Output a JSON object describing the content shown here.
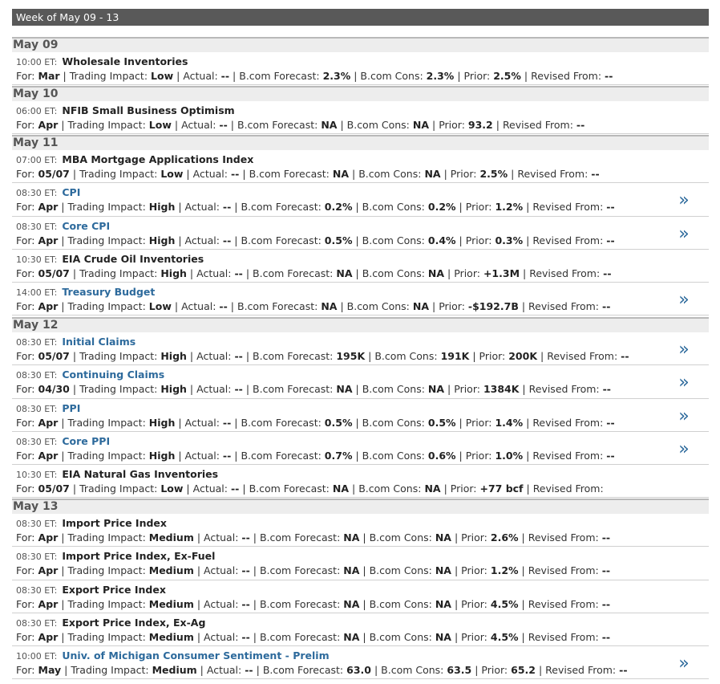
{
  "week_title": "Week of May 09 - 13",
  "labels": {
    "et": "ET:",
    "for": "For:",
    "impact": "Trading Impact:",
    "actual": "Actual:",
    "forecast": "B.com Forecast:",
    "cons": "B.com Cons:",
    "prior": "Prior:",
    "revised": "Revised From:",
    "sep": "|"
  },
  "arrow_glyph": "»",
  "days": [
    {
      "date": "May 09",
      "events": [
        {
          "time": "10:00",
          "name": "Wholesale Inventories",
          "link": false,
          "for": "Mar",
          "impact": "Low",
          "actual": "--",
          "forecast": "2.3%",
          "cons": "2.3%",
          "prior": "2.5%",
          "revised": "--",
          "arrow": false
        }
      ]
    },
    {
      "date": "May 10",
      "events": [
        {
          "time": "06:00",
          "name": "NFIB Small Business Optimism",
          "link": false,
          "for": "Apr",
          "impact": "Low",
          "actual": "--",
          "forecast": "NA",
          "cons": "NA",
          "prior": "93.2",
          "revised": "--",
          "arrow": false
        }
      ]
    },
    {
      "date": "May 11",
      "events": [
        {
          "time": "07:00",
          "name": "MBA Mortgage Applications Index",
          "link": false,
          "for": "05/07",
          "impact": "Low",
          "actual": "--",
          "forecast": "NA",
          "cons": "NA",
          "prior": "2.5%",
          "revised": "--",
          "arrow": false
        },
        {
          "time": "08:30",
          "name": "CPI",
          "link": true,
          "for": "Apr",
          "impact": "High",
          "actual": "--",
          "forecast": "0.2%",
          "cons": "0.2%",
          "prior": "1.2%",
          "revised": "--",
          "arrow": true
        },
        {
          "time": "08:30",
          "name": "Core CPI",
          "link": true,
          "for": "Apr",
          "impact": "High",
          "actual": "--",
          "forecast": "0.5%",
          "cons": "0.4%",
          "prior": "0.3%",
          "revised": "--",
          "arrow": true
        },
        {
          "time": "10:30",
          "name": "EIA Crude Oil Inventories",
          "link": false,
          "for": "05/07",
          "impact": "High",
          "actual": "--",
          "forecast": "NA",
          "cons": "NA",
          "prior": "+1.3M",
          "revised": "--",
          "arrow": false
        },
        {
          "time": "14:00",
          "name": "Treasury Budget",
          "link": true,
          "for": "Apr",
          "impact": "Low",
          "actual": "--",
          "forecast": "NA",
          "cons": "NA",
          "prior": "-$192.7B",
          "revised": "--",
          "arrow": true
        }
      ]
    },
    {
      "date": "May 12",
      "events": [
        {
          "time": "08:30",
          "name": "Initial Claims",
          "link": true,
          "for": "05/07",
          "impact": "High",
          "actual": "--",
          "forecast": "195K",
          "cons": "191K",
          "prior": "200K",
          "revised": "--",
          "arrow": true
        },
        {
          "time": "08:30",
          "name": "Continuing Claims",
          "link": true,
          "for": "04/30",
          "impact": "High",
          "actual": "--",
          "forecast": "NA",
          "cons": "NA",
          "prior": "1384K",
          "revised": "--",
          "arrow": true
        },
        {
          "time": "08:30",
          "name": "PPI",
          "link": true,
          "for": "Apr",
          "impact": "High",
          "actual": "--",
          "forecast": "0.5%",
          "cons": "0.5%",
          "prior": "1.4%",
          "revised": "--",
          "arrow": true
        },
        {
          "time": "08:30",
          "name": "Core PPI",
          "link": true,
          "for": "Apr",
          "impact": "High",
          "actual": "--",
          "forecast": "0.7%",
          "cons": "0.6%",
          "prior": "1.0%",
          "revised": "--",
          "arrow": true
        },
        {
          "time": "10:30",
          "name": "EIA Natural Gas Inventories",
          "link": false,
          "for": "05/07",
          "impact": "Low",
          "actual": "--",
          "forecast": "NA",
          "cons": "NA",
          "prior": "+77 bcf",
          "revised": "",
          "arrow": false
        }
      ]
    },
    {
      "date": "May 13",
      "events": [
        {
          "time": "08:30",
          "name": "Import Price Index",
          "link": false,
          "for": "Apr",
          "impact": "Medium",
          "actual": "--",
          "forecast": "NA",
          "cons": "NA",
          "prior": "2.6%",
          "revised": "--",
          "arrow": false
        },
        {
          "time": "08:30",
          "name": "Import Price Index, Ex-Fuel",
          "link": false,
          "for": "Apr",
          "impact": "Medium",
          "actual": "--",
          "forecast": "NA",
          "cons": "NA",
          "prior": "1.2%",
          "revised": "--",
          "arrow": false
        },
        {
          "time": "08:30",
          "name": "Export Price Index",
          "link": false,
          "for": "Apr",
          "impact": "Medium",
          "actual": "--",
          "forecast": "NA",
          "cons": "NA",
          "prior": "4.5%",
          "revised": "--",
          "arrow": false
        },
        {
          "time": "08:30",
          "name": "Export Price Index, Ex-Ag",
          "link": false,
          "for": "Apr",
          "impact": "Medium",
          "actual": "--",
          "forecast": "NA",
          "cons": "NA",
          "prior": "4.5%",
          "revised": "--",
          "arrow": false
        },
        {
          "time": "10:00",
          "name": "Univ. of Michigan Consumer Sentiment - Prelim",
          "link": true,
          "for": "May",
          "impact": "Medium",
          "actual": "--",
          "forecast": "63.0",
          "cons": "63.5",
          "prior": "65.2",
          "revised": "--",
          "arrow": true
        }
      ]
    }
  ]
}
